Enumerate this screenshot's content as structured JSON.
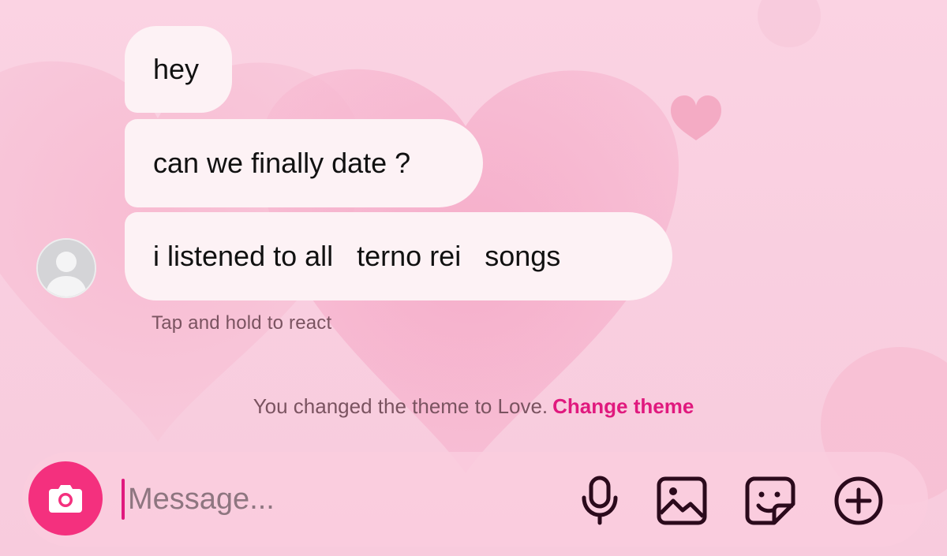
{
  "conversation": {
    "messages": [
      {
        "text": "hey"
      },
      {
        "text": "can we finally date ?"
      },
      {
        "text": "i listened to all   terno rei   songs"
      }
    ],
    "react_hint": "Tap and hold to react",
    "avatar_icon": "default-user-avatar-icon"
  },
  "theme_notice": {
    "text": "You changed the theme to Love.",
    "action_label": "Change theme",
    "action_color": "#e0197e"
  },
  "composer": {
    "placeholder": "Message...",
    "camera_color": "#f4307e",
    "icons": [
      "camera-icon",
      "microphone-icon",
      "gallery-icon",
      "sticker-icon",
      "plus-icon"
    ]
  },
  "theme": {
    "background": "#f9cfe0",
    "bubble": "#fdf2f5",
    "icon_color": "#2b0a1c"
  }
}
